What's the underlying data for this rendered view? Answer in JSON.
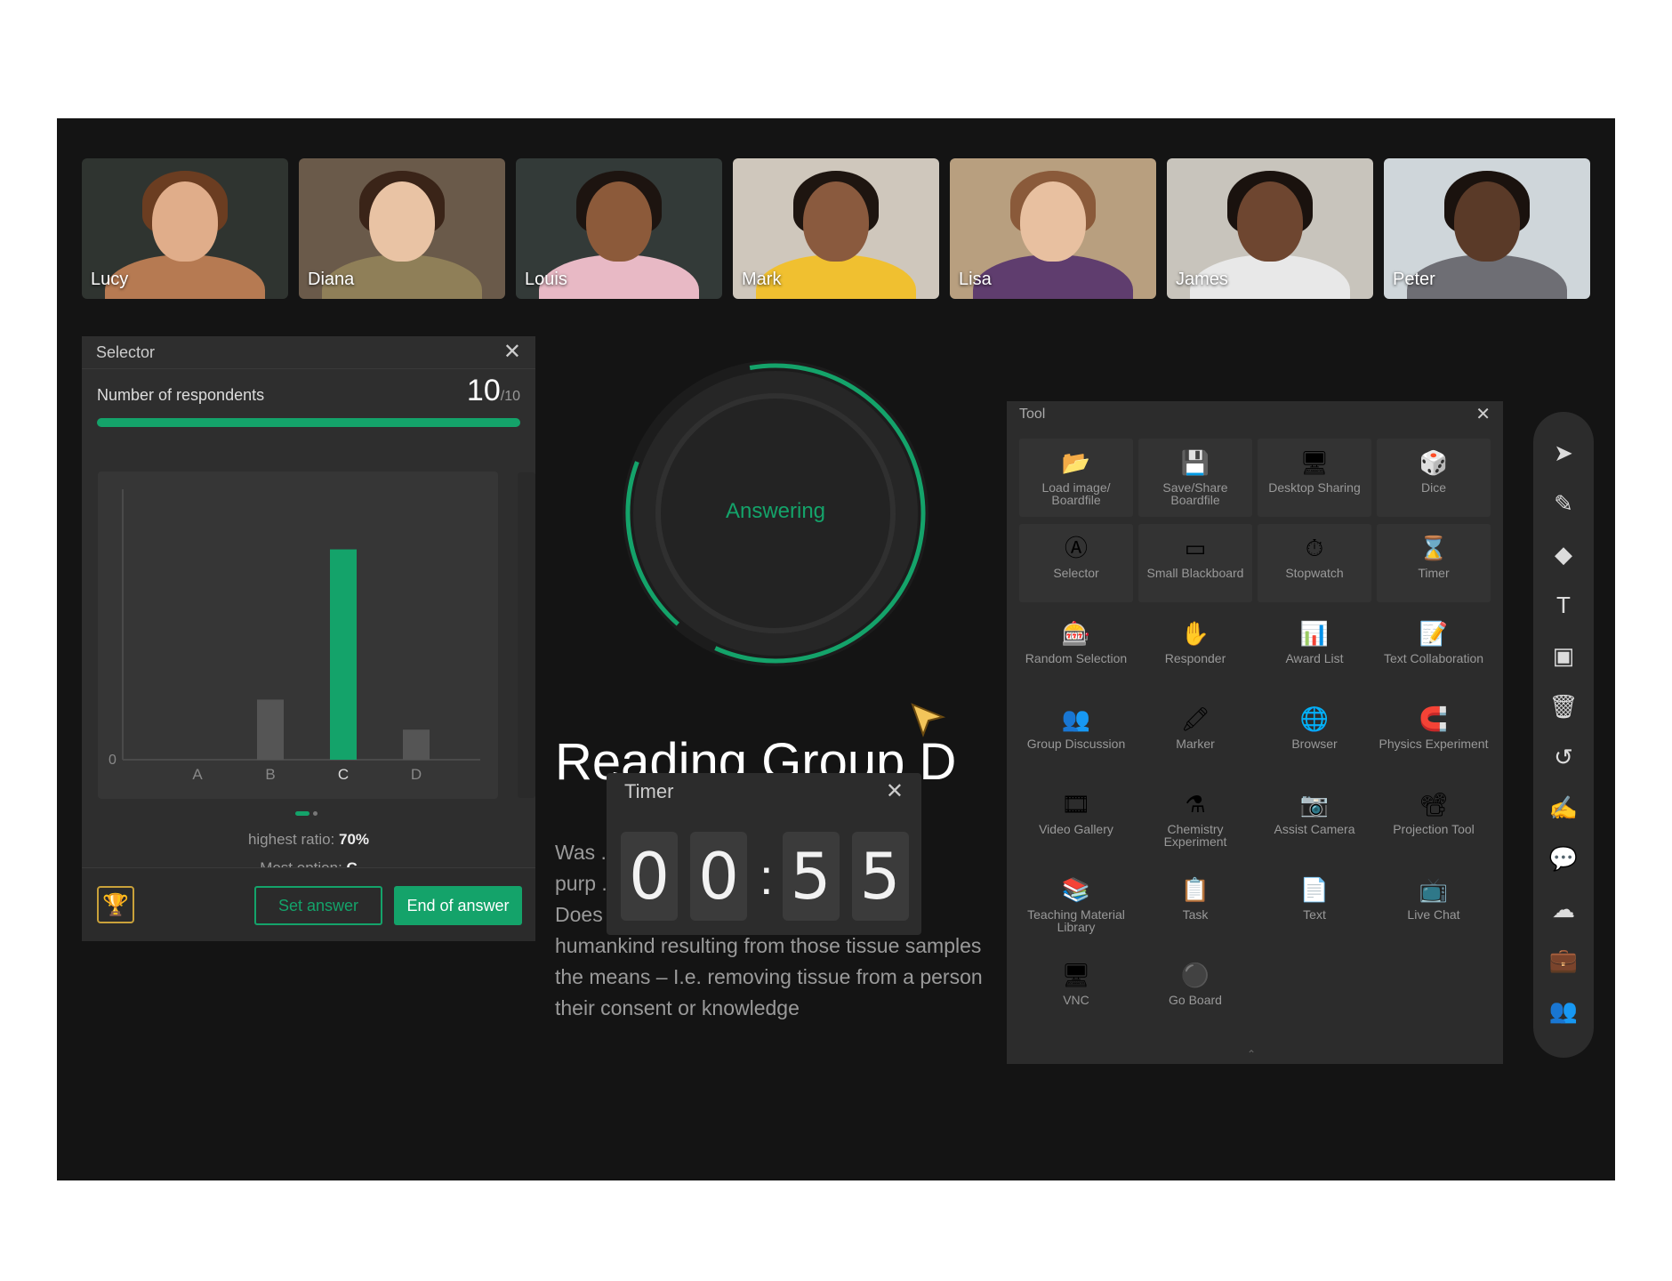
{
  "participants": [
    {
      "name": "Lucy",
      "bg": "#2f3430",
      "skin": "#e0ad8a",
      "hair": "#6b3d21",
      "shirt": "#b67a52"
    },
    {
      "name": "Diana",
      "bg": "#6a5a4a",
      "skin": "#e9c3a4",
      "hair": "#3a2418",
      "shirt": "#8f7f58"
    },
    {
      "name": "Louis",
      "bg": "#333a38",
      "skin": "#8c5a3a",
      "hair": "#1d1410",
      "shirt": "#e8b9c5"
    },
    {
      "name": "Mark",
      "bg": "#cfc7bc",
      "skin": "#8a5a3e",
      "hair": "#1e1510",
      "shirt": "#f0c030"
    },
    {
      "name": "Lisa",
      "bg": "#b89f7f",
      "skin": "#e8c0a0",
      "hair": "#8a5a3a",
      "shirt": "#5f3d6e"
    },
    {
      "name": "James",
      "bg": "#c8c4bc",
      "skin": "#6e4630",
      "hair": "#1a120e",
      "shirt": "#e8e8e8"
    },
    {
      "name": "Peter",
      "bg": "#cfd6da",
      "skin": "#5a3a28",
      "hair": "#1a120e",
      "shirt": "#6e6e74"
    }
  ],
  "selector": {
    "title": "Selector",
    "respondents_label": "Number of respondents",
    "respondents_count": "10",
    "respondents_total": "/10",
    "progress_fraction": 1.0,
    "highest_ratio_label": "highest ratio:",
    "highest_ratio_value": "70%",
    "most_option_label": "Most option:",
    "most_option_value": "C",
    "set_answer": "Set answer",
    "end_of_answer": "End of answer",
    "trophy_icon": "trophy-icon"
  },
  "chart_data": {
    "type": "bar",
    "categories": [
      "A",
      "B",
      "C",
      "D"
    ],
    "values": [
      0,
      2,
      7,
      1
    ],
    "highlight": "C",
    "y_tick_labels": [
      "0"
    ],
    "ylim": [
      0,
      9
    ],
    "colors": {
      "highlight": "#14a36a",
      "default": "#555555"
    }
  },
  "answering": {
    "label": "Answering"
  },
  "document": {
    "title": "Reading Group D",
    "lines": [
      "Was ... ose samp",
      "purp ... trolled co",
      "Does ... benefit to",
      "humankind resulting from those tissue samples",
      "the means – I.e. removing tissue from a person",
      "their consent or knowledge"
    ]
  },
  "timer": {
    "title": "Timer",
    "digits": [
      "0",
      "0",
      "5",
      "5"
    ],
    "separator": ":"
  },
  "tool_panel": {
    "title": "Tool",
    "items": [
      {
        "label": "Load image/ Boardfile",
        "icon": "folder-icon",
        "glyph": "📂",
        "boxed": true
      },
      {
        "label": "Save/Share Boardfile",
        "icon": "save-icon",
        "glyph": "💾",
        "boxed": true
      },
      {
        "label": "Desktop Sharing",
        "icon": "desktop-sharing-icon",
        "glyph": "🖥",
        "boxed": true
      },
      {
        "label": "Dice",
        "icon": "dice-icon",
        "glyph": "🎲",
        "boxed": true
      },
      {
        "label": "Selector",
        "icon": "selector-icon",
        "glyph": "Ⓐ",
        "boxed": true
      },
      {
        "label": "Small Blackboard",
        "icon": "blackboard-icon",
        "glyph": "▭",
        "boxed": true
      },
      {
        "label": "Stopwatch",
        "icon": "stopwatch-icon",
        "glyph": "⏱",
        "boxed": true
      },
      {
        "label": "Timer",
        "icon": "hourglass-icon",
        "glyph": "⌛",
        "boxed": true
      },
      {
        "label": "Random Selection",
        "icon": "random-selection-icon",
        "glyph": "🎰",
        "boxed": false
      },
      {
        "label": "Responder",
        "icon": "responder-icon",
        "glyph": "✋",
        "boxed": false
      },
      {
        "label": "Award List",
        "icon": "award-list-icon",
        "glyph": "📊",
        "boxed": false
      },
      {
        "label": "Text Collaboration",
        "icon": "text-collaboration-icon",
        "glyph": "📝",
        "boxed": false
      },
      {
        "label": "Group Discussion",
        "icon": "group-discussion-icon",
        "glyph": "👥",
        "boxed": false
      },
      {
        "label": "Marker",
        "icon": "marker-icon",
        "glyph": "🖍",
        "boxed": false
      },
      {
        "label": "Browser",
        "icon": "browser-icon",
        "glyph": "🌐",
        "boxed": false
      },
      {
        "label": "Physics Experiment",
        "icon": "magnet-icon",
        "glyph": "🧲",
        "boxed": false
      },
      {
        "label": "Video Gallery",
        "icon": "video-gallery-icon",
        "glyph": "🎞",
        "boxed": false
      },
      {
        "label": "Chemistry Experiment",
        "icon": "flask-icon",
        "glyph": "⚗",
        "boxed": false
      },
      {
        "label": "Assist Camera",
        "icon": "camera-icon",
        "glyph": "📷",
        "boxed": false
      },
      {
        "label": "Projection Tool",
        "icon": "projection-icon",
        "glyph": "📽",
        "boxed": false
      },
      {
        "label": "Teaching Material Library",
        "icon": "library-icon",
        "glyph": "📚",
        "boxed": false
      },
      {
        "label": "Task",
        "icon": "task-icon",
        "glyph": "📋",
        "boxed": false
      },
      {
        "label": "Text",
        "icon": "text-doc-icon",
        "glyph": "📄",
        "boxed": false
      },
      {
        "label": "Live Chat",
        "icon": "live-chat-icon",
        "glyph": "📺",
        "boxed": false
      },
      {
        "label": "VNC",
        "icon": "vnc-icon",
        "glyph": "🖥",
        "boxed": false
      },
      {
        "label": "Go Board",
        "icon": "go-board-icon",
        "glyph": "⚫",
        "boxed": false
      }
    ]
  },
  "toolbar": [
    {
      "icon": "pointer-icon",
      "glyph": "➤"
    },
    {
      "icon": "pen-icon",
      "glyph": "✎"
    },
    {
      "icon": "eraser-icon",
      "glyph": "◆"
    },
    {
      "icon": "text-tool-icon",
      "glyph": "T"
    },
    {
      "icon": "image-icon",
      "glyph": "▣"
    },
    {
      "icon": "trash-icon",
      "glyph": "🗑"
    },
    {
      "icon": "undo-icon",
      "glyph": "↺"
    },
    {
      "icon": "edit-icon",
      "glyph": "✍"
    },
    {
      "icon": "chat-icon",
      "glyph": "💬"
    },
    {
      "icon": "cloud-icon",
      "glyph": "☁"
    },
    {
      "icon": "toolbox-icon",
      "glyph": "💼"
    },
    {
      "icon": "users-icon",
      "glyph": "👥"
    }
  ]
}
